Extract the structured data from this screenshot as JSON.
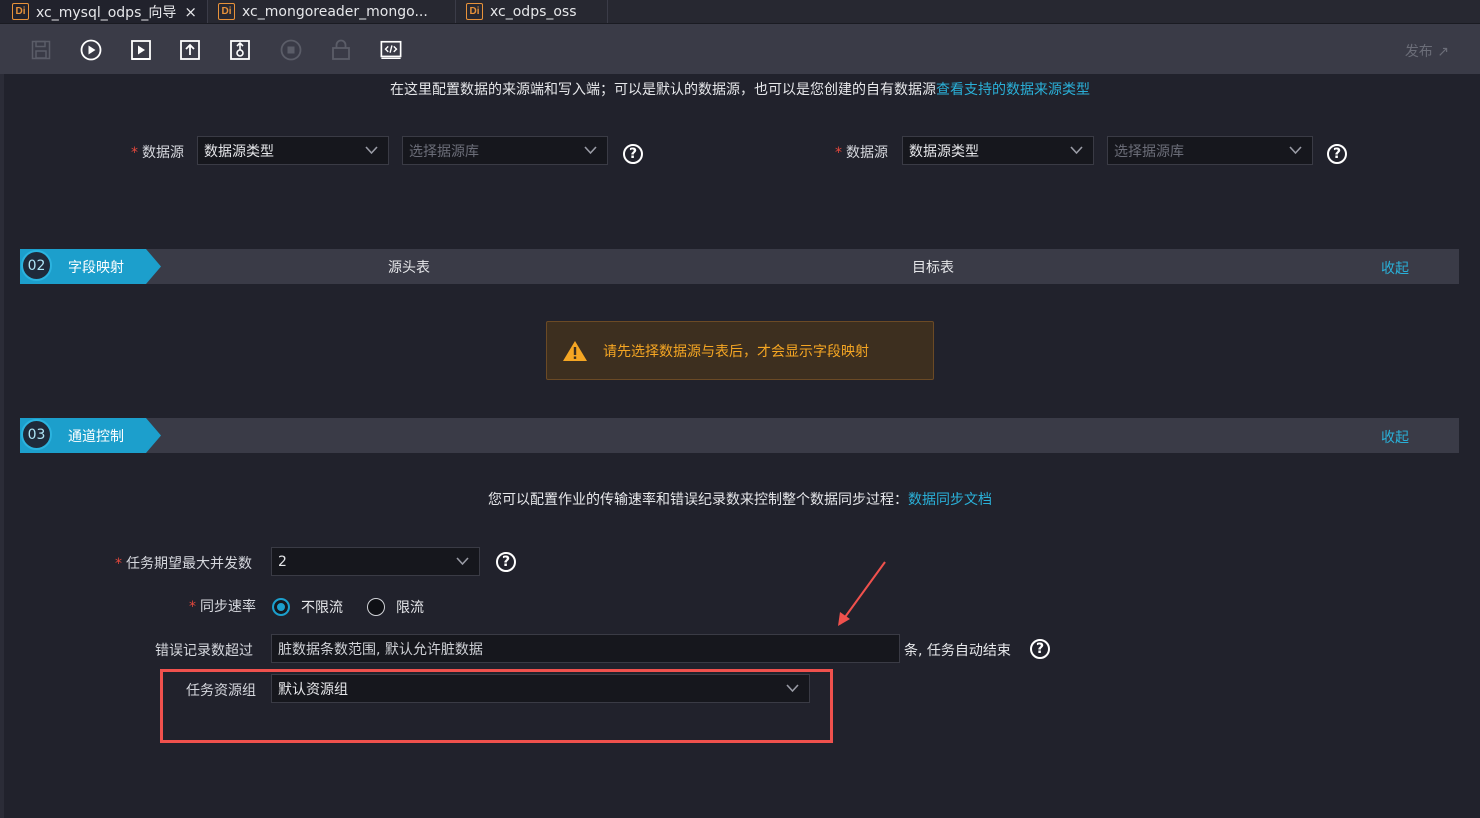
{
  "tabs": [
    {
      "label": "xc_mysql_odps_向导",
      "icon": "Di",
      "close": "×",
      "active": true
    },
    {
      "label": "xc_mongoreader_mongo...",
      "icon": "Di"
    },
    {
      "label": "xc_odps_oss",
      "icon": "Di"
    }
  ],
  "toolbar": {
    "icons": [
      "save-icon",
      "run-icon",
      "run-params-icon",
      "submit-icon",
      "deploy-check-icon",
      "stop-icon",
      "lock-icon",
      "code-icon"
    ],
    "publish": "发布 ↗"
  },
  "source_info": {
    "text": "在这里配置数据的来源端和写入端；可以是默认的数据源，也可以是您创建的自有数据源",
    "link": "查看支持的数据来源类型"
  },
  "source": {
    "label": "数据源",
    "type_value": "数据源类型",
    "db_placeholder": "选择据源库"
  },
  "target": {
    "label": "数据源",
    "type_value": "数据源类型",
    "db_placeholder": "选择据源库"
  },
  "section_mapping": {
    "number": "02",
    "title": "字段映射",
    "source_col": "源头表",
    "target_col": "目标表",
    "collapse": "收起",
    "warning": "请先选择数据源与表后，才会显示字段映射"
  },
  "section_channel": {
    "number": "03",
    "title": "通道控制",
    "collapse": "收起",
    "desc": "您可以配置作业的传输速率和错误纪录数来控制整个数据同步过程：",
    "desc_link": "数据同步文档"
  },
  "form": {
    "concurrency_label": "任务期望最大并发数",
    "concurrency_value": "2",
    "rate_label": "同步速率",
    "rate_unlimited": "不限流",
    "rate_limited": "限流",
    "rate_selected": "不限流",
    "error_label": "错误记录数超过",
    "error_placeholder": "脏数据条数范围, 默认允许脏数据",
    "error_suffix": "条, 任务自动结束",
    "resource_label": "任务资源组",
    "resource_value": "默认资源组"
  },
  "colors": {
    "accent": "#1c9fcc",
    "link": "#2ab0d8",
    "warning": "#f5a623",
    "highlight": "#f0514d",
    "required": "#e6483d"
  }
}
